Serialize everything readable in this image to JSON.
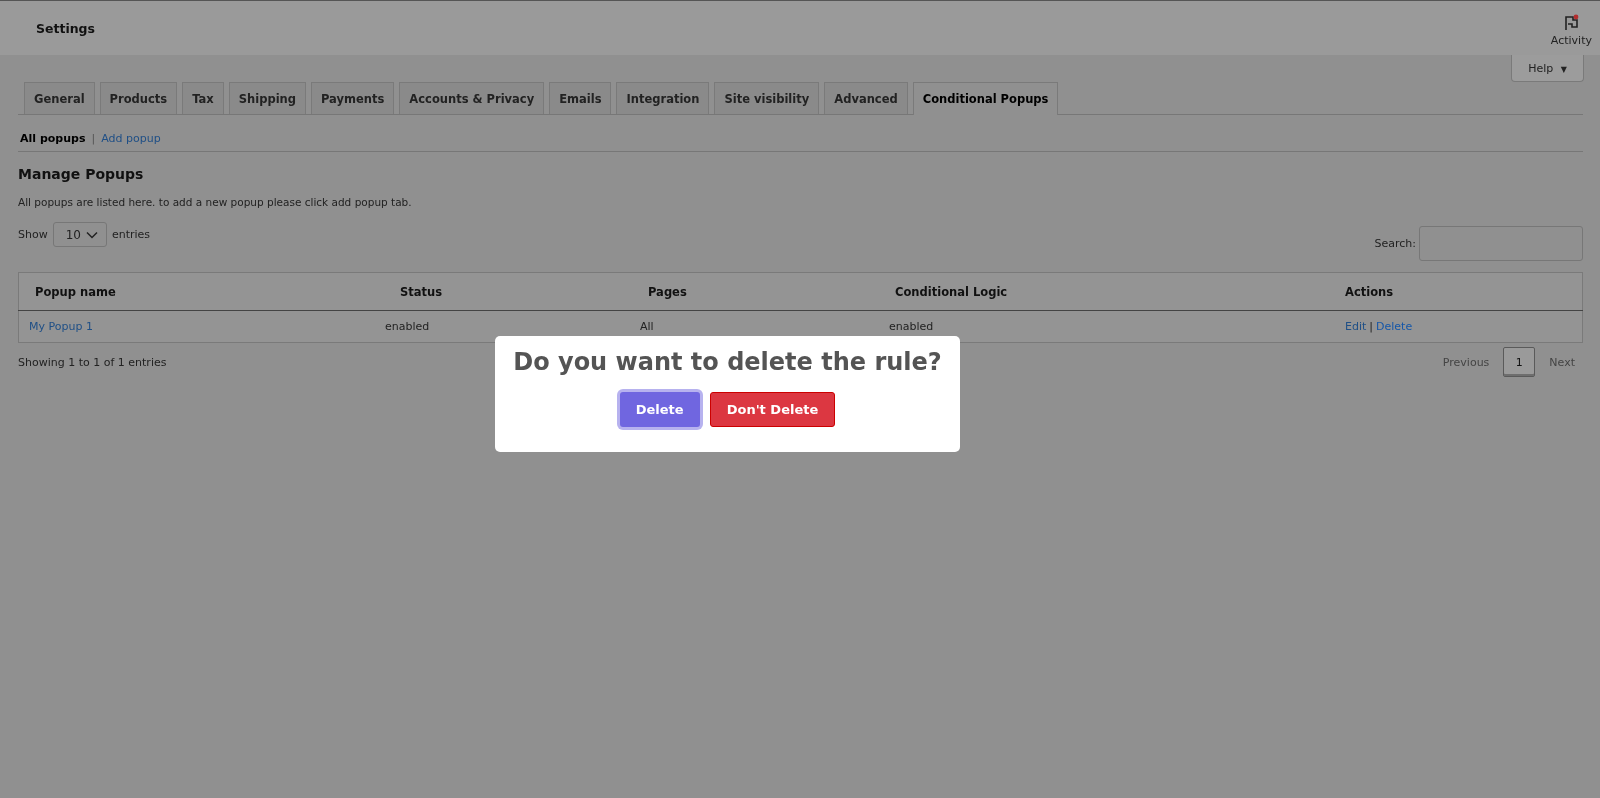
{
  "top_bar": {
    "title": "Settings",
    "activity": {
      "label": "Activity",
      "has_notification": true
    }
  },
  "help_button": {
    "label": "Help",
    "caret": "▼"
  },
  "tabs": [
    {
      "label": "General",
      "selected": false
    },
    {
      "label": "Products",
      "selected": false
    },
    {
      "label": "Tax",
      "selected": false
    },
    {
      "label": "Shipping",
      "selected": false
    },
    {
      "label": "Payments",
      "selected": false
    },
    {
      "label": "Accounts & Privacy",
      "selected": false
    },
    {
      "label": "Emails",
      "selected": false
    },
    {
      "label": "Integration",
      "selected": false
    },
    {
      "label": "Site visibility",
      "selected": false
    },
    {
      "label": "Advanced",
      "selected": false
    },
    {
      "label": "Conditional Popups",
      "selected": true
    }
  ],
  "subnav": [
    {
      "label": "All popups",
      "selected": true
    },
    {
      "label": "Add popup",
      "selected": false
    }
  ],
  "subnav_separator": "|",
  "heading": "Manage Popups",
  "description": "All popups are listed here. to add a new popup please click add popup tab.",
  "length_control": {
    "before": "Show",
    "value": "10",
    "after": "entries"
  },
  "search": {
    "label": "Search:"
  },
  "table": {
    "columns": [
      "Popup name",
      "Status",
      "Pages",
      "Conditional Logic",
      "Actions"
    ],
    "rows": [
      {
        "name": "My Popup 1",
        "status": "enabled",
        "pages": "All",
        "logic": "enabled",
        "actions": [
          "Edit",
          "Delete"
        ],
        "action_separator": "|"
      }
    ]
  },
  "info": "Showing 1 to 1 of 1 entries",
  "pagination": {
    "previous": "Previous",
    "pages": [
      {
        "label": "1",
        "selected": true
      }
    ],
    "next": "Next"
  },
  "dialog": {
    "title": "Do you want to delete the rule?",
    "confirm": {
      "label": "Delete",
      "focused": true
    },
    "cancel": {
      "label": "Don't Delete"
    }
  }
}
